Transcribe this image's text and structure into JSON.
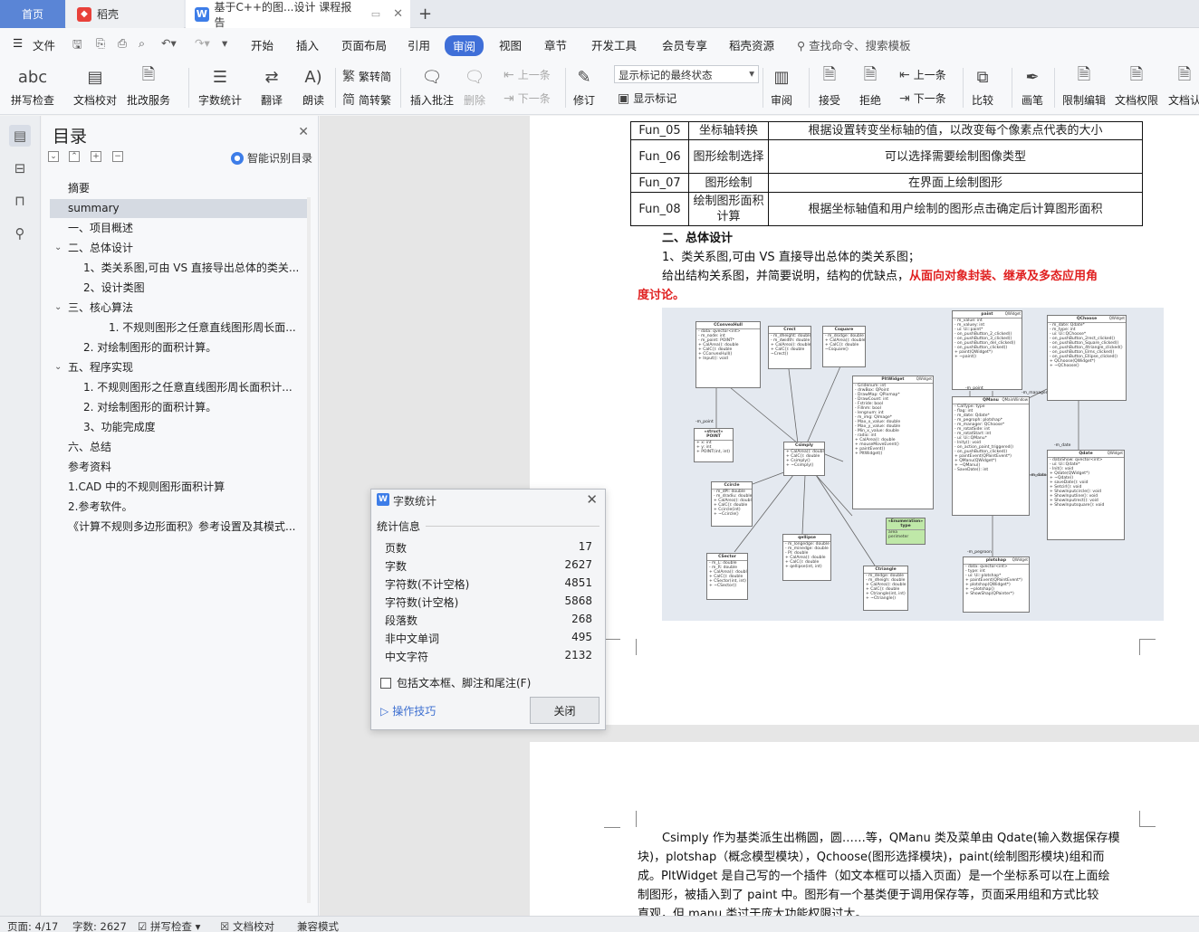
{
  "tabs": {
    "home": "首页",
    "daoke": "稻壳",
    "doc": "基于C++的图...设计 课程报告"
  },
  "menu": {
    "file": "文件",
    "items": [
      "开始",
      "插入",
      "页面布局",
      "引用",
      "审阅",
      "视图",
      "章节",
      "开发工具",
      "会员专享",
      "稻壳资源"
    ],
    "active": "审阅",
    "search": "查找命令、搜索模板"
  },
  "ribbon": {
    "spellcheck": "拼写检查",
    "doc_check": "文档校对",
    "correction": "批改服务",
    "word_count": "字数统计",
    "translate": "翻译",
    "read_aloud": "朗读",
    "to_traditional": "繁转简",
    "to_simplified": "简转繁",
    "insert_comment": "插入批注",
    "delete": "删除",
    "prev_comment": "上一条",
    "next_comment": "下一条",
    "track_changes": "修订",
    "markup_state": "显示标记的最终状态",
    "show_markup": "显示标记",
    "review": "审阅",
    "accept": "接受",
    "reject": "拒绝",
    "prev": "上一条",
    "next": "下一条",
    "compare": "比较",
    "ink": "画笔",
    "restrict_edit": "限制编辑",
    "doc_permission": "文档权限",
    "doc_cert": "文档认"
  },
  "toc": {
    "title": "目录",
    "smart": "智能识别目录",
    "items": [
      {
        "label": "摘要"
      },
      {
        "label": "summary"
      },
      {
        "label": "一、项目概述"
      },
      {
        "label": "二、总体设计"
      },
      {
        "label": "1、类关系图,可由 VS 直接导出总体的类关..."
      },
      {
        "label": "2、设计类图"
      },
      {
        "label": "三、核心算法"
      },
      {
        "label": "1. 不规则图形之任意直线图形周长面..."
      },
      {
        "label": "2. 对绘制图形的面积计算。"
      },
      {
        "label": "五、程序实现"
      },
      {
        "label": "1. 不规则图形之任意直线图形周长面积计..."
      },
      {
        "label": "2. 对绘制图形的面积计算。"
      },
      {
        "label": "3、功能完成度"
      },
      {
        "label": "六、总结"
      },
      {
        "label": "参考资料"
      },
      {
        "label": "1.CAD 中的不规则图形面积计算"
      },
      {
        "label": "2.参考软件。"
      },
      {
        "label": "《计算不规则多边形面积》参考设置及其模式..."
      }
    ]
  },
  "table": {
    "rows": [
      {
        "id": "Fun_05",
        "name": "坐标轴转换",
        "desc": "根据设置转变坐标轴的值，以改变每个像素点代表的大小"
      },
      {
        "id": "Fun_06",
        "name": "图形绘制选择",
        "desc": "可以选择需要绘制图像类型"
      },
      {
        "id": "Fun_07",
        "name": "图形绘制",
        "desc": "在界面上绘制图形"
      },
      {
        "id": "Fun_08",
        "name": "绘制图形面积计算",
        "desc": "根据坐标轴值和用户绘制的图形点击确定后计算图形面积"
      }
    ]
  },
  "body": {
    "heading": "二、总体设计",
    "p1": "1、类关系图,可由 VS 直接导出总体的类关系图；",
    "p2a": "给出结构关系图，并简要说明，结构的优缺点，",
    "p2b": "从面向对象封装、继承及多态应用角",
    "p2c": "度讨论。",
    "p3": [
      "Csimply 作为基类派生出椭圆，圆……等，QManu 类及菜单由 Qdate(输入数据保存模",
      "块)，plotshap（概念模型模块），Qchoose(图形选择模块)，paint(绘制图形模块)组和而",
      "成。PltWidget 是自己写的一个插件（如文本框可以插入页面）是一个坐标系可以在上面绘",
      "制图形，被插入到了 paint 中。图形有一个基类便于调用保存等，页面采用组和方式比较",
      "直观，但 manu 类过于庞大功能权限过大。"
    ]
  },
  "uml": {
    "classes": [
      {
        "key": "cc",
        "name": "CConvexHull"
      },
      {
        "key": "cr",
        "name": "Crect"
      },
      {
        "key": "cq",
        "name": "Csquare"
      },
      {
        "key": "pw",
        "name": "PltWidget",
        "tag": "QWidget"
      },
      {
        "key": "pa",
        "name": "paint",
        "tag": "QWidget"
      },
      {
        "key": "qc",
        "name": "QChoose",
        "tag": "QWidget"
      },
      {
        "key": "qm",
        "name": "QManu",
        "tag": "QMainWindow"
      },
      {
        "key": "pt",
        "name": "POINT"
      },
      {
        "key": "cs",
        "name": "Csimply"
      },
      {
        "key": "ci",
        "name": "Ccircle"
      },
      {
        "key": "qd",
        "name": "Qdate",
        "tag": "QWidget"
      },
      {
        "key": "en",
        "name": "type"
      },
      {
        "key": "se",
        "name": "CSector"
      },
      {
        "key": "el",
        "name": "qellipse"
      },
      {
        "key": "tr",
        "name": "Ctriangle"
      },
      {
        "key": "ps",
        "name": "plotshap",
        "tag": "QWidget"
      }
    ],
    "labels": [
      "-m_point",
      "-m_manager",
      "-m_point",
      "-m_date",
      "-m_date",
      "-m_pegroon",
      "«Enumeration»"
    ]
  },
  "dialog": {
    "title": "字数统计",
    "section": "统计信息",
    "stats": [
      {
        "label": "页数",
        "value": "17"
      },
      {
        "label": "字数",
        "value": "2627"
      },
      {
        "label": "字符数(不计空格)",
        "value": "4851"
      },
      {
        "label": "字符数(计空格)",
        "value": "5868"
      },
      {
        "label": "段落数",
        "value": "268"
      },
      {
        "label": "非中文单词",
        "value": "495"
      },
      {
        "label": "中文字符",
        "value": "2132"
      }
    ],
    "checkbox": "包括文本框、脚注和尾注(F)",
    "tips": "操作技巧",
    "close": "关闭"
  },
  "status": {
    "page": "页面: 4/17",
    "words": "字数: 2627",
    "spell": "拼写检查",
    "doccheck": "文档校对",
    "compat": "兼容模式"
  },
  "colors": {
    "accent": "#3f6fd8",
    "home_tab": "#5a85d6",
    "emphasis": "#e02020"
  }
}
